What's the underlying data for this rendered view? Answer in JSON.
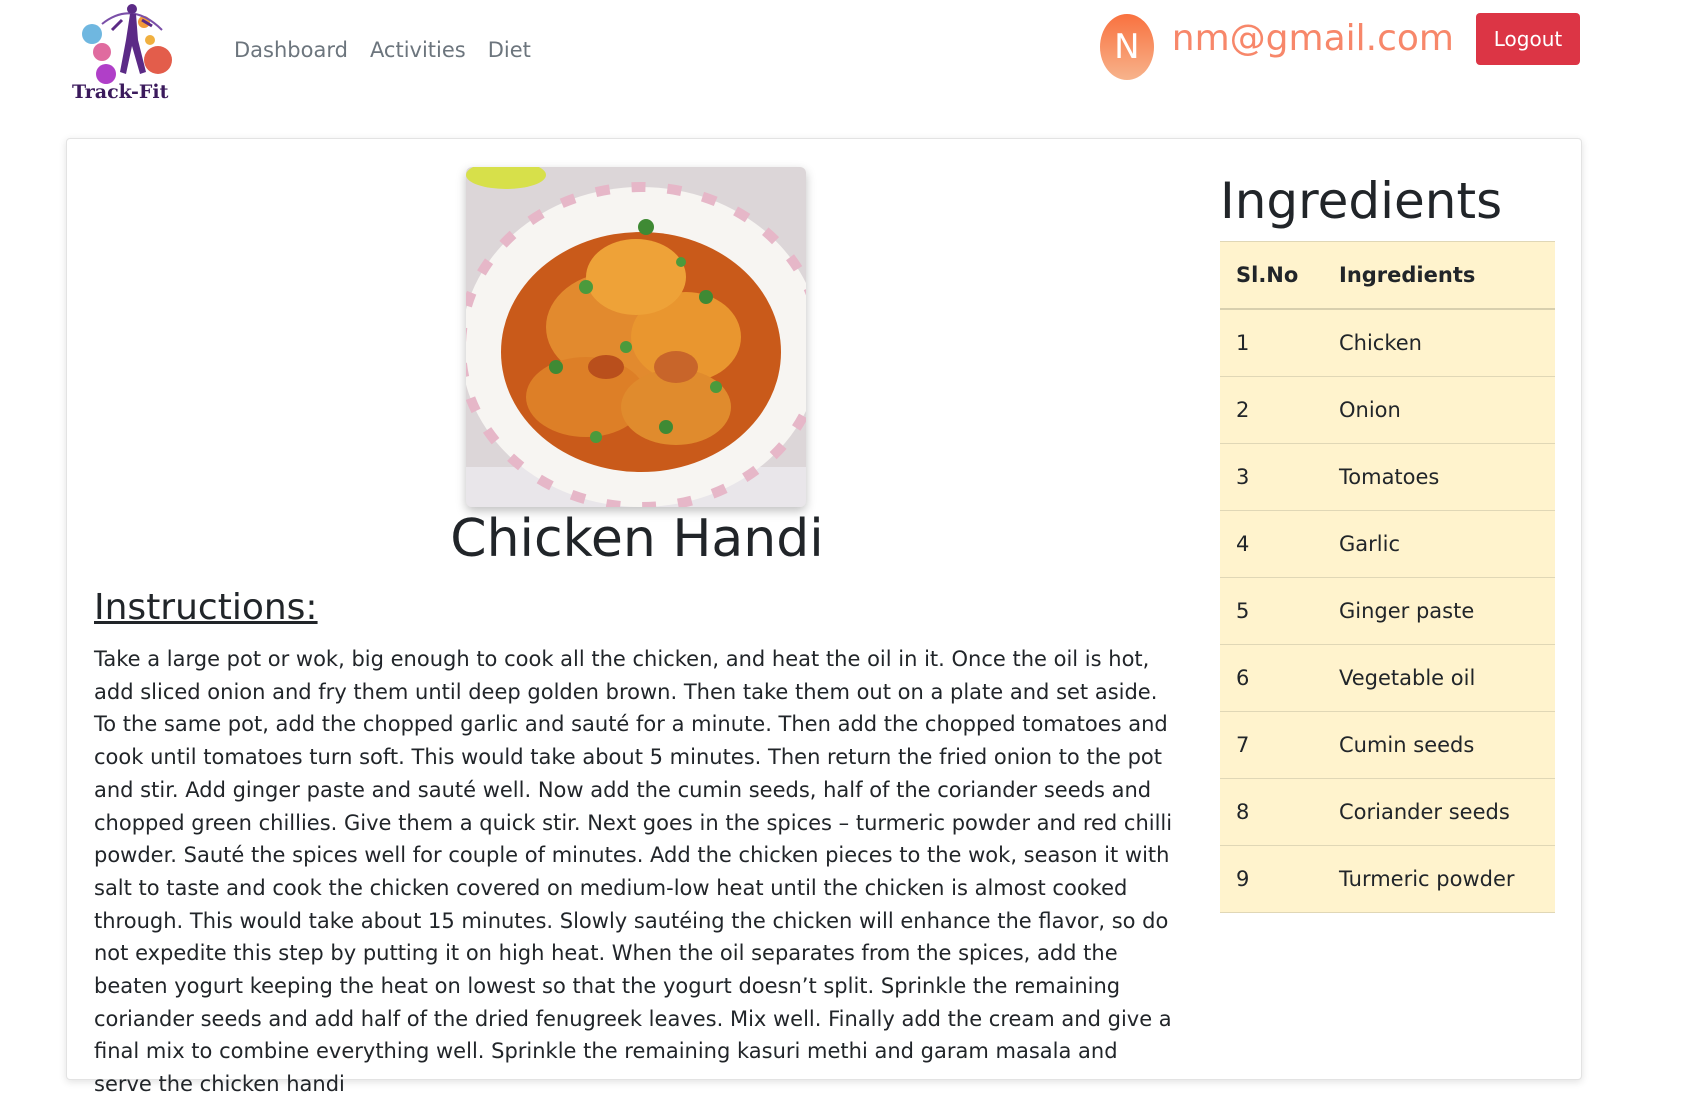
{
  "navbar": {
    "logo_text": "Track-Fit",
    "links": [
      "Dashboard",
      "Activities",
      "Diet"
    ],
    "user": {
      "avatar_initial": "N",
      "email": "nm@gmail.com"
    },
    "logout_label": "Logout"
  },
  "recipe": {
    "title": "Chicken Handi",
    "instructions_heading": "Instructions:",
    "instructions_text": "Take a large pot or wok, big enough to cook all the chicken, and heat the oil in it. Once the oil is hot, add sliced onion and fry them until deep golden brown. Then take them out on a plate and set aside. To the same pot, add the chopped garlic and sauté for a minute. Then add the chopped tomatoes and cook until tomatoes turn soft. This would take about 5 minutes. Then return the fried onion to the pot and stir. Add ginger paste and sauté well. Now add the cumin seeds, half of the coriander seeds and chopped green chillies. Give them a quick stir. Next goes in the spices – turmeric powder and red chilli powder. Sauté the spices well for couple of minutes. Add the chicken pieces to the wok, season it with salt to taste and cook the chicken covered on medium-low heat until the chicken is almost cooked through. This would take about 15 minutes. Slowly sautéing the chicken will enhance the flavor, so do not expedite this step by putting it on high heat. When the oil separates from the spices, add the beaten yogurt keeping the heat on lowest so that the yogurt doesn’t split. Sprinkle the remaining coriander seeds and add half of the dried fenugreek leaves. Mix well. Finally add the cream and give a final mix to combine everything well. Sprinkle the remaining kasuri methi and garam masala and serve the chicken handi"
  },
  "ingredients": {
    "heading": "Ingredients",
    "columns": [
      "Sl.No",
      "Ingredients"
    ],
    "rows": [
      [
        "1",
        "Chicken"
      ],
      [
        "2",
        "Onion"
      ],
      [
        "3",
        "Tomatoes"
      ],
      [
        "4",
        "Garlic"
      ],
      [
        "5",
        "Ginger paste"
      ],
      [
        "6",
        "Vegetable oil"
      ],
      [
        "7",
        "Cumin seeds"
      ],
      [
        "8",
        "Coriander seeds"
      ],
      [
        "9",
        "Turmeric powder"
      ]
    ]
  },
  "colors": {
    "logout_button": "#dc3545",
    "email_text": "#f7876a",
    "avatar_gradient_top": "#f9713f",
    "table_background": "#fff3cd",
    "nav_link": "#6c757d"
  }
}
